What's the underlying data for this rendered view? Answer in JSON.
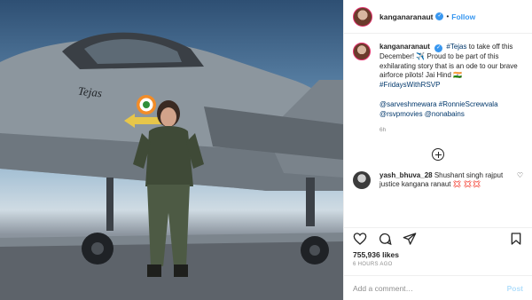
{
  "header": {
    "username": "kanganaranaut",
    "separator": "•",
    "follow_label": "Follow"
  },
  "caption": {
    "username": "kanganaranaut",
    "hashtag_1": "#Tejas",
    "text_1": " to take off this December! ",
    "plane_emoji": "✈️",
    "text_2": " Proud to be part of this exhilarating story that is an ode to our brave airforce pilots! Jai Hind ",
    "flag_emoji": "🇮🇳",
    "hashtag_2": "#FridaysWithRSVP",
    "mentions": "@sarveshmewara #RonnieScrewvala @rsvpmovies @nonabains",
    "time": "6h"
  },
  "comment": {
    "username": "yash_bhuva_28",
    "text": " Shushant singh rajput justice kangana ranaut",
    "emojis": "💢 💢💢"
  },
  "icons": {
    "heart": "heart-icon",
    "comment": "comment-icon",
    "share": "share-icon",
    "save": "save-icon"
  },
  "likes": "755,936 likes",
  "posted_time": "6 HOURS AGO",
  "add_comment": {
    "placeholder": "Add a comment…",
    "post_label": "Post"
  },
  "image": {
    "jet_name": "Tejas"
  },
  "colors": {
    "link_blue": "#3897f0",
    "hashtag": "#00376b",
    "muted": "#8e8e8e"
  }
}
